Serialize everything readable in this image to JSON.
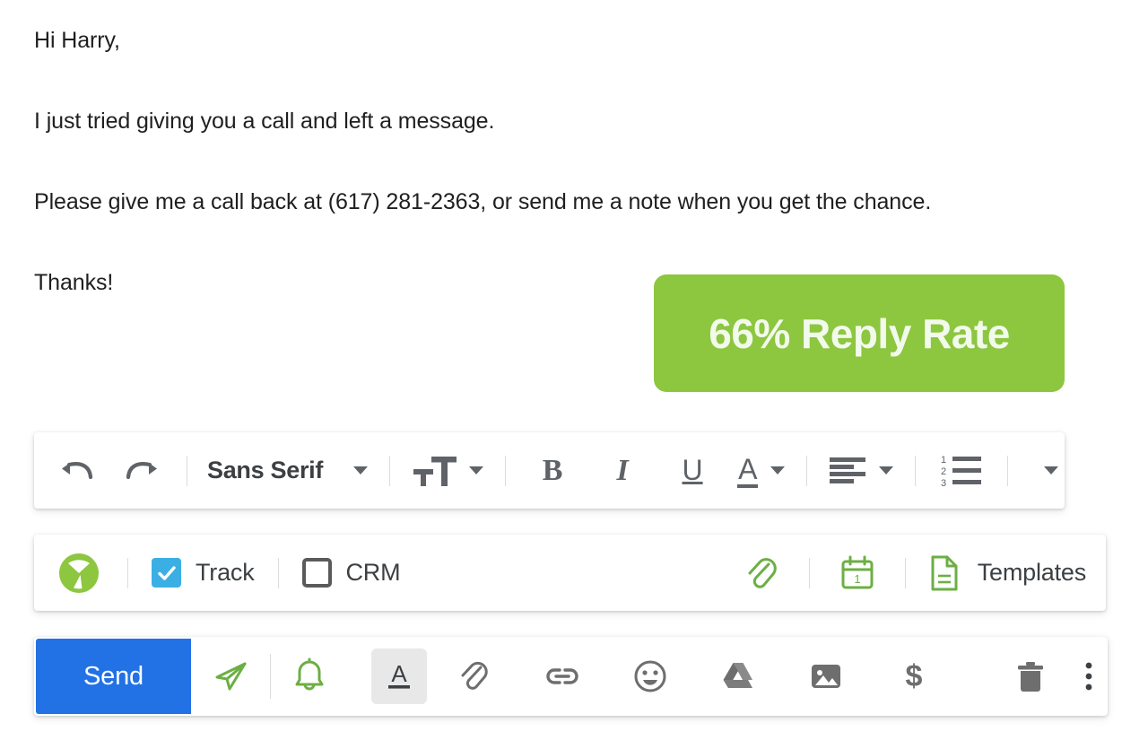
{
  "email_body": {
    "lines": [
      "Hi Harry,",
      "I just tried giving you a call and left a message.",
      "Please give me a call back at (617) 281-2363, or send me a note when you get the chance.",
      "Thanks!"
    ],
    "greeting": "Hi Harry,",
    "paragraph_1": "I just tried giving you a call and left a message.",
    "paragraph_2": "Please give me a call back at (617) 281-2363, or send me a note when you get the chance.",
    "closing": "Thanks!",
    "phone_number": "(617) 281-2363"
  },
  "badge": {
    "label": "66% Reply Rate",
    "percent": "66%",
    "metric": "Reply Rate",
    "background_color": "#8DC63F",
    "text_color": "#F2FAEC"
  },
  "format_toolbar": {
    "undo": "undo",
    "redo": "redo",
    "font_family_value": "Sans Serif",
    "font_size": "text-size",
    "bold": "B",
    "italic": "I",
    "underline": "U",
    "text_color": "A",
    "align": "align-left",
    "numbered_list": "numbered-list",
    "more": "more-format-options"
  },
  "yesware_bar": {
    "logo": "yesware-logo",
    "track": {
      "label": "Track",
      "checked": true,
      "checkbox_color": "#3BAFE3"
    },
    "crm": {
      "label": "CRM",
      "checked": false
    },
    "attach": "attachment-icon",
    "schedule": "calendar-icon",
    "templates": {
      "label": "Templates",
      "icon": "document-icon"
    },
    "accent_color": "#6CAF44"
  },
  "send_bar": {
    "send_label": "Send",
    "send_color": "#2272E5",
    "yesware_send": "send-now-icon",
    "reminder": "bell-icon",
    "formatting": "format-text-icon",
    "attach_file": "paperclip-icon",
    "insert_link": "link-icon",
    "insert_emoji": "emoji-icon",
    "insert_drive": "google-drive-icon",
    "insert_photo": "photo-icon",
    "insert_money": "dollar-icon",
    "discard": "trash-icon",
    "more_options": "more-options-icon"
  }
}
